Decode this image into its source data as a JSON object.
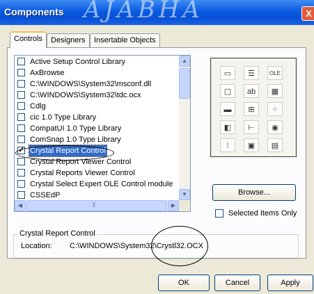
{
  "window": {
    "title": "Components",
    "close_glyph": "X",
    "watermark": "AJABHA"
  },
  "tabs": [
    {
      "label": "Controls",
      "active": true
    },
    {
      "label": "Designers",
      "active": false
    },
    {
      "label": "Insertable Objects",
      "active": false
    }
  ],
  "list": {
    "items": [
      {
        "label": "Active Setup Control Library",
        "checked": false
      },
      {
        "label": "AxBrowse",
        "checked": false
      },
      {
        "label": "C:\\WINDOWS\\System32\\msconf.dll",
        "checked": false
      },
      {
        "label": "C:\\WINDOWS\\System32\\tdc.ocx",
        "checked": false
      },
      {
        "label": "Cdlg",
        "checked": false
      },
      {
        "label": "cic 1.0 Type Library",
        "checked": false
      },
      {
        "label": "CompatUI 1.0 Type Library",
        "checked": false
      },
      {
        "label": "ComSnap 1.0 Type Library",
        "checked": false
      },
      {
        "label": "Crystal Report Control",
        "checked": true,
        "selected": true
      },
      {
        "label": "Crystal Report Viewer Control",
        "checked": false
      },
      {
        "label": "Crystal Reports Viewer Control",
        "checked": false
      },
      {
        "label": "Crystal Select Expert OLE Control module",
        "checked": false
      },
      {
        "label": "CSSEdP",
        "checked": false
      }
    ],
    "scroll_up_glyph": "▲",
    "scroll_down_glyph": "▼",
    "scroll_left_glyph": "◀",
    "scroll_right_glyph": "▶",
    "hthumb_grip": "⦀"
  },
  "preview_icons": [
    {
      "name": "control-icon-1",
      "glyph": "▭"
    },
    {
      "name": "control-icon-2",
      "glyph": "☰"
    },
    {
      "name": "ole-icon",
      "glyph": "OLE"
    },
    {
      "name": "control-icon-4",
      "glyph": "▢"
    },
    {
      "name": "control-icon-5",
      "glyph": "ab"
    },
    {
      "name": "control-icon-6",
      "glyph": "▦"
    },
    {
      "name": "control-icon-7",
      "glyph": "▬"
    },
    {
      "name": "tree-icon",
      "glyph": "⊞"
    },
    {
      "name": "grid-icon",
      "glyph": "⁘"
    },
    {
      "name": "control-icon-10",
      "glyph": "◧"
    },
    {
      "name": "control-icon-11",
      "glyph": "⊢"
    },
    {
      "name": "control-icon-12",
      "glyph": "◉"
    },
    {
      "name": "control-icon-13",
      "glyph": "⁞"
    },
    {
      "name": "control-icon-14",
      "glyph": "▣"
    },
    {
      "name": "control-icon-15",
      "glyph": "▤"
    }
  ],
  "browse_label": "Browse...",
  "selected_only_label": "Selected Items Only",
  "details": {
    "group_title": "Crystal Report Control",
    "location_label": "Location:",
    "location_value": "C:\\WINDOWS\\System32\\Crystl32.OCX"
  },
  "buttons": {
    "ok": "OK",
    "cancel": "Cancel",
    "apply": "Apply"
  },
  "colors": {
    "title_bar": "#0a5be0",
    "selection": "#316ac5",
    "face": "#ece9d8"
  }
}
